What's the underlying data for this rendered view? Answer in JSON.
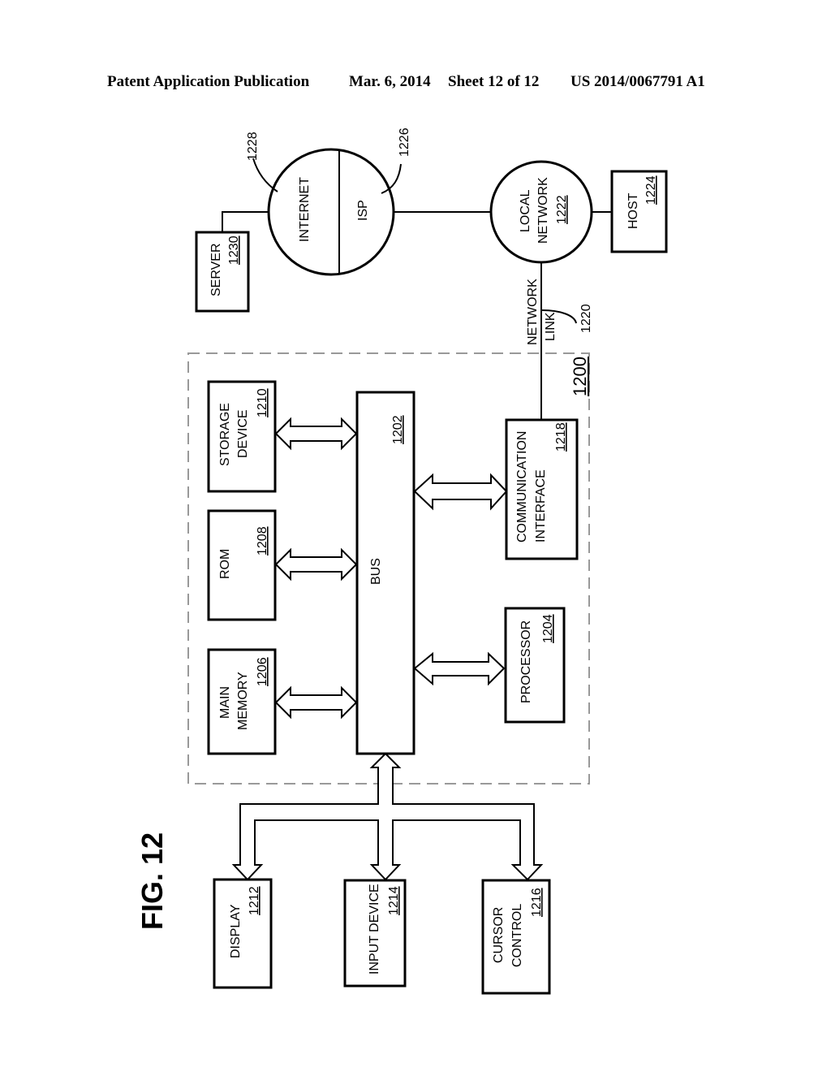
{
  "header": {
    "publication": "Patent Application Publication",
    "date": "Mar. 6, 2014",
    "sheet": "Sheet 12 of 12",
    "number": "US 2014/0067791 A1"
  },
  "figure": {
    "title": "FIG. 12",
    "system_ref": "1200",
    "bus": {
      "label": "BUS",
      "ref": "1202"
    },
    "processor": {
      "label": "PROCESSOR",
      "ref": "1204"
    },
    "main_memory": {
      "line1": "MAIN",
      "line2": "MEMORY",
      "ref": "1206"
    },
    "rom": {
      "label": "ROM",
      "ref": "1208"
    },
    "storage": {
      "line1": "STORAGE",
      "line2": "DEVICE",
      "ref": "1210"
    },
    "display": {
      "label": "DISPLAY",
      "ref": "1212"
    },
    "input_device": {
      "label": "INPUT DEVICE",
      "ref": "1214"
    },
    "cursor_control": {
      "line1": "CURSOR",
      "line2": "CONTROL",
      "ref": "1216"
    },
    "comm_interface": {
      "line1": "COMMUNICATION",
      "line2": "INTERFACE",
      "ref": "1218"
    },
    "network_link": {
      "line1": "NETWORK",
      "line2": "LINK",
      "ref": "1220"
    },
    "local_network": {
      "line1": "LOCAL",
      "line2": "NETWORK",
      "ref": "1222"
    },
    "host": {
      "label": "HOST",
      "ref": "1224"
    },
    "isp": {
      "label": "ISP",
      "ref": "1226"
    },
    "internet": {
      "label": "INTERNET",
      "ref": "1228"
    },
    "server": {
      "label": "SERVER",
      "ref": "1230"
    }
  }
}
